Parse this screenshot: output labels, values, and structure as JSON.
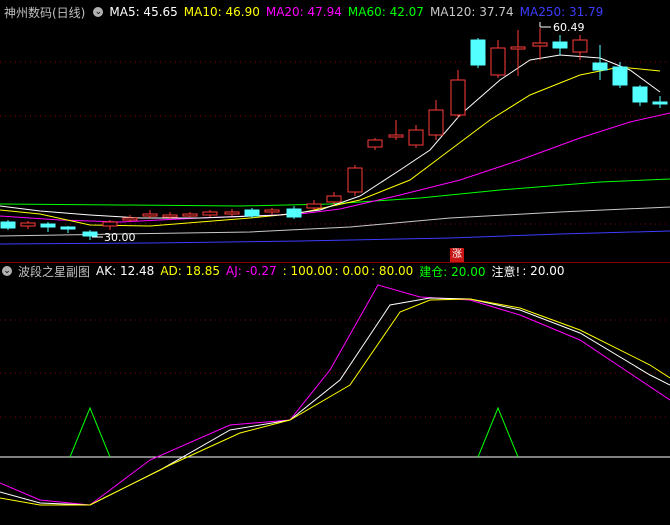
{
  "main": {
    "title": "神州数码(日线)",
    "indicators": [
      {
        "label": "MA5: 45.65",
        "color": "#ffffff"
      },
      {
        "label": "MA10: 46.90",
        "color": "#ffff00"
      },
      {
        "label": "MA20: 47.94",
        "color": "#ff00ff"
      },
      {
        "label": "MA60: 42.07",
        "color": "#00ff00"
      },
      {
        "label": "MA120: 37.74",
        "color": "#c8c8c8"
      },
      {
        "label": "MA250: 31.79",
        "color": "#3c3cff"
      }
    ],
    "high_label": "60.49",
    "low_label": "30.00",
    "badge": "涨"
  },
  "sub": {
    "title": "波段之星副图",
    "values": [
      {
        "label": "AK: 12.48",
        "color": "#ffffff"
      },
      {
        "label": "AD: 18.85",
        "color": "#ffff00"
      },
      {
        "label": "AJ: -0.27",
        "color": "#ff00ff"
      },
      {
        "label": ": 100.00",
        "color": "#ffff00"
      },
      {
        "label": ": 0.00",
        "color": "#ffff00"
      },
      {
        "label": ": 80.00",
        "color": "#ffff00"
      },
      {
        "label": "建仓: 20.00",
        "color": "#00ff00"
      },
      {
        "label": "注意!",
        "color": "#ffffff"
      },
      {
        "label": ": 20.00",
        "color": "#ffffff"
      }
    ]
  },
  "colors": {
    "up": "#ff3c3c",
    "down": "#54ffff",
    "grid": "#8b0000",
    "signal": "#00ff00"
  }
}
